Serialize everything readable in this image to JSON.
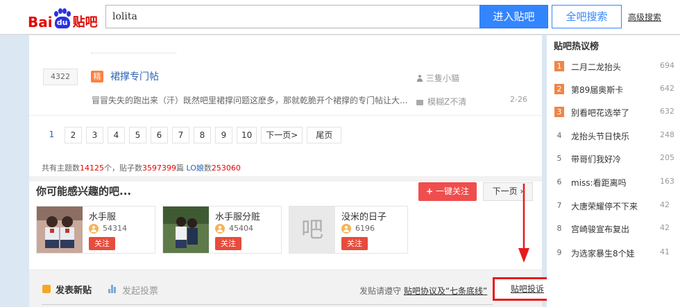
{
  "header": {
    "logo": {
      "bai": "Bai",
      "du": "du",
      "tieba": "贴吧"
    },
    "search": {
      "value": "lolita"
    },
    "enter_button": "进入贴吧",
    "search_all_button": "全吧搜索",
    "advanced_link": "高级搜索"
  },
  "thread": {
    "reply_count": "4322",
    "badge": "精",
    "title": "裙撑专门帖",
    "author": "三隻小貓",
    "abstract": "冒冒失失的跑出来（汗）既然吧里裙撑问题这麽多，那就乾脆开个裙撑的专门帖让大...",
    "last_reply_user": "模糊Z不清",
    "date": "2-26"
  },
  "pager": {
    "pages": [
      "1",
      "2",
      "3",
      "4",
      "5",
      "6",
      "7",
      "8",
      "9",
      "10"
    ],
    "next": "下一页>",
    "last": "尾页"
  },
  "stats": {
    "label1": "共有主题数",
    "topics": "14125",
    "label2": "个，贴子数",
    "posts": "3597399",
    "label3": "篇",
    "lo_label": "LO娘",
    "label4": "数",
    "members": "253060"
  },
  "interest": {
    "title": "你可能感兴趣的吧...",
    "follow_all": "一键关注",
    "follow_all_plus": "+",
    "next": "下一页",
    "cards": [
      {
        "name": "水手服",
        "fans": "54314",
        "follow": "关注"
      },
      {
        "name": "水手服分赃",
        "fans": "45404",
        "follow": "关注"
      },
      {
        "name": "没米的日子",
        "fans": "6196",
        "follow": "关注",
        "placeholder": "吧"
      }
    ]
  },
  "post_bar": {
    "new_post": "发表新贴",
    "start_vote": "发起投票",
    "notice_prefix": "发贴请遵守",
    "notice_link": "贴吧协议及“七条底线”",
    "complain": "贴吧投诉"
  },
  "sidebar": {
    "title": "贴吧热议榜",
    "items": [
      {
        "rank": "1",
        "name": "二月二龙抬头",
        "count": "694"
      },
      {
        "rank": "2",
        "name": "第89届奥斯卡",
        "count": "642"
      },
      {
        "rank": "3",
        "name": "别看吧花选举了",
        "count": "632"
      },
      {
        "rank": "4",
        "name": "龙抬头节日快乐",
        "count": "248"
      },
      {
        "rank": "5",
        "name": "带哥们我好冷",
        "count": "205"
      },
      {
        "rank": "6",
        "name": "miss:看距离吗",
        "count": "163"
      },
      {
        "rank": "7",
        "name": "大唐荣耀停不下来",
        "count": "42"
      },
      {
        "rank": "8",
        "name": "宫崎骏宣布复出",
        "count": "42"
      },
      {
        "rank": "9",
        "name": "为选家暴生8个娃",
        "count": "41"
      }
    ]
  },
  "colors": {
    "accent": "#3385ff",
    "highlight": "#e8191a",
    "rank_top": "#f08548"
  }
}
